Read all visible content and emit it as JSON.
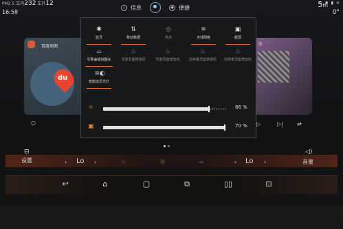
{
  "status": {
    "pm_label": "PM2.5",
    "in_label": "车内",
    "in_value": "232",
    "out_label": "车外",
    "out_value": "12",
    "time": "16:58",
    "range_value": "5",
    "range_unit": "m",
    "temperature": "0°"
  },
  "tabs": [
    {
      "label": "信息",
      "icon": "info-icon"
    },
    {
      "label": "便捷",
      "icon": "settings-icon"
    }
  ],
  "background": {
    "map_title": "百度地图",
    "map_logo": "du",
    "music_label": "乐"
  },
  "panel": {
    "row1": [
      {
        "label": "蓝牙",
        "icon": "bluetooth-icon",
        "glyph": "✱",
        "active": true
      },
      {
        "label": "移动数据",
        "icon": "mobile-data-icon",
        "glyph": "⇅",
        "active": true
      },
      {
        "label": "热点",
        "icon": "hotspot-icon",
        "glyph": "◎",
        "active": false
      },
      {
        "label": "无线网络",
        "icon": "wifi-icon",
        "glyph": "≋",
        "active": true
      },
      {
        "label": "截屏",
        "icon": "screenshot-icon",
        "glyph": "▣",
        "active": true
      }
    ],
    "row2": [
      {
        "label": "引擎盖模拟翻关",
        "icon": "hood-icon",
        "glyph": "⌓",
        "active": true
      },
      {
        "label": "驾驶员座椅通风",
        "icon": "seat-vent-icon",
        "glyph": "♨",
        "active": false
      },
      {
        "label": "驾驶员座椅加热",
        "icon": "seat-heat-icon",
        "glyph": "♨",
        "active": false
      },
      {
        "label": "前排乘员座椅通风",
        "icon": "passenger-seat-vent-icon",
        "glyph": "♨",
        "active": false
      },
      {
        "label": "前排乘员座椅加热",
        "icon": "passenger-seat-heat-icon",
        "glyph": "♨",
        "active": false
      }
    ],
    "row3": [
      {
        "label": "智能远近光灯",
        "icon": "auto-headlight-icon",
        "glyph": "≡◐",
        "active": true
      }
    ],
    "brightness": {
      "value": "86",
      "unit": "%",
      "level": 0.86
    },
    "volume": {
      "value": "70",
      "unit": "%",
      "level": 1.0
    }
  },
  "climate": {
    "settings_label": "设置",
    "left_temp": "Lo",
    "right_temp": "Lo",
    "volume_label": "音量"
  },
  "colors": {
    "accent": "#e8743b",
    "panel_bg": "#18191b"
  }
}
